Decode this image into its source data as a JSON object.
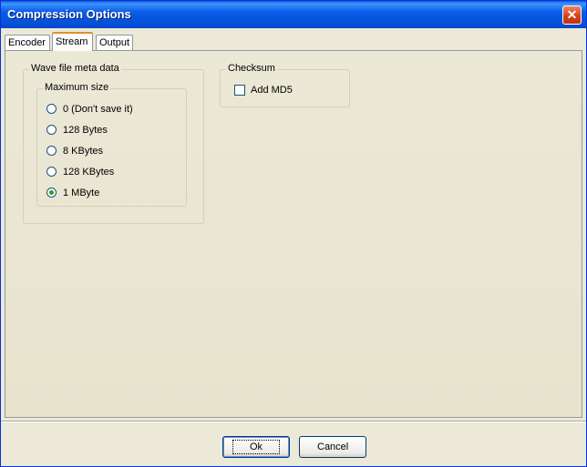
{
  "window": {
    "title": "Compression Options",
    "close_glyph": "✕"
  },
  "tabs": [
    {
      "label": "Encoder",
      "active": false
    },
    {
      "label": "Stream",
      "active": true
    },
    {
      "label": "Output",
      "active": false
    }
  ],
  "meta_group": {
    "legend": "Wave file meta data",
    "size_group": {
      "legend": "Maximum size",
      "options": [
        {
          "label": "0 (Don't save it)",
          "checked": false
        },
        {
          "label": "128 Bytes",
          "checked": false
        },
        {
          "label": "8 KBytes",
          "checked": false
        },
        {
          "label": "128 KBytes",
          "checked": false
        },
        {
          "label": "1 MByte",
          "checked": true
        }
      ]
    }
  },
  "checksum_group": {
    "legend": "Checksum",
    "add_md5": {
      "label": "Add MD5",
      "checked": false
    }
  },
  "buttons": {
    "ok": "Ok",
    "cancel": "Cancel"
  }
}
